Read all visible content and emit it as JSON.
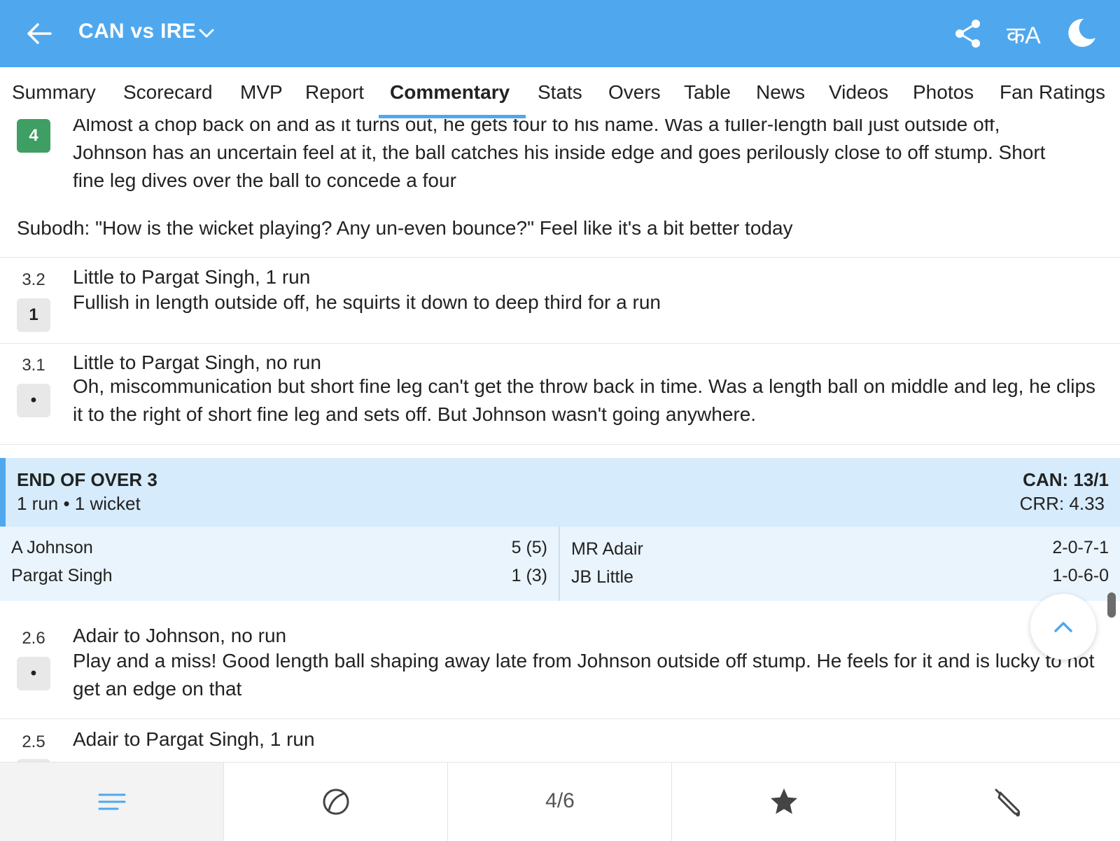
{
  "header": {
    "title": "CAN vs IRE",
    "lang_label": "कA",
    "back_icon": "arrow-left-icon",
    "dropdown_icon": "chevron-down-icon",
    "share_icon": "share-icon",
    "theme_icon": "moon-icon"
  },
  "tabs": [
    {
      "label": "Summary"
    },
    {
      "label": "Scorecard"
    },
    {
      "label": "MVP"
    },
    {
      "label": "Report"
    },
    {
      "label": "Commentary",
      "active": true
    },
    {
      "label": "Stats"
    },
    {
      "label": "Overs"
    },
    {
      "label": "Table"
    },
    {
      "label": "News"
    },
    {
      "label": "Videos"
    },
    {
      "label": "Photos"
    },
    {
      "label": "Fan Ratings"
    }
  ],
  "commentary": {
    "top_entry": {
      "badge": "4",
      "line1": "Almost a chop back on and as it turns out, he gets four to his name. Was a fuller-length ball just outside off,",
      "line2": "Johnson has an uncertain feel at it, the ball catches his inside edge and goes perilously close to off stump. Short",
      "line3": "fine leg dives over the ball to concede a four"
    },
    "note": "Subodh: \"How is the wicket playing? Any un-even bounce?\" Feel like it's a bit better today",
    "entries": [
      {
        "over": "3.2",
        "badge": "1",
        "headline": "Little to Pargat Singh, 1 run",
        "text": "Fullish in length outside off, he squirts it down to deep third for a run"
      },
      {
        "over": "3.1",
        "badge": "•",
        "headline": "Little to Pargat Singh, no run",
        "text": "Oh, miscommunication but short fine leg can't get the throw back in time. Was a length ball on middle and leg, he clips it to the right of short fine leg and sets off. But Johnson wasn't going anywhere."
      },
      {
        "over": "2.6",
        "badge": "•",
        "headline": "Adair to Johnson, no run",
        "text": "Play and a miss! Good length ball shaping away late from Johnson outside off stump. He feels for it and is lucky to not get an edge on that"
      },
      {
        "over": "2.5",
        "badge": "",
        "headline": "Adair to Pargat Singh, 1 run"
      }
    ],
    "end_of_over": {
      "title": "END OF OVER 3",
      "summary": "1 run • 1 wicket",
      "score": "CAN: 13/1",
      "crr": "CRR: 4.33",
      "batsmen": [
        {
          "name": "A Johnson",
          "figures": "5 (5)"
        },
        {
          "name": "Pargat Singh",
          "figures": "1 (3)"
        }
      ],
      "bowlers": [
        {
          "name": "MR Adair",
          "figures": "2-0-7-1"
        },
        {
          "name": "JB Little",
          "figures": "1-0-6-0"
        }
      ]
    }
  },
  "scroll_top_icon": "chevron-up-icon",
  "bottom_nav": {
    "menu_icon": "menu-lines-icon",
    "ball_icon": "cricket-ball-icon",
    "page_indicator": "4/6",
    "star_icon": "star-icon",
    "bat_icon": "cricket-bat-icon"
  },
  "colors": {
    "header_bg": "#4fa8ee",
    "four_badge": "#3f9e63",
    "over_bg": "#d6ebfb",
    "players_bg": "#eaf4fc"
  }
}
